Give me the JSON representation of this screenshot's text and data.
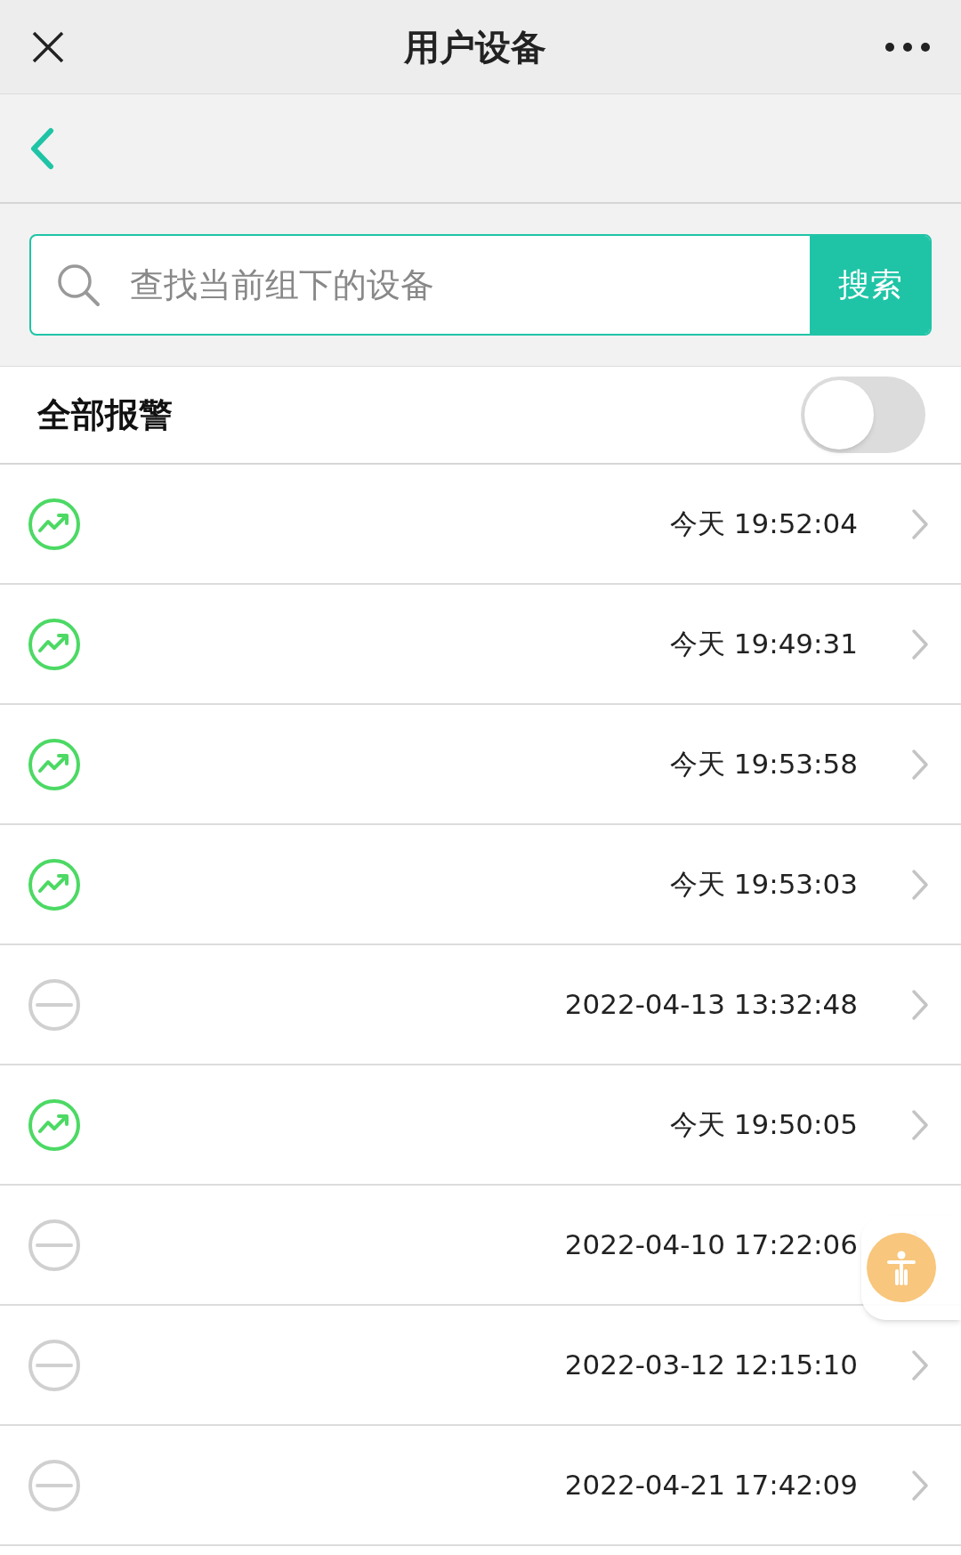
{
  "top_bar": {
    "title": "用户设备"
  },
  "search": {
    "placeholder": "查找当前组下的设备",
    "button": "搜索"
  },
  "alarm_toggle": {
    "label": "全部报警",
    "on": false
  },
  "devices": [
    {
      "online": true,
      "time": "今天 19:52:04"
    },
    {
      "online": true,
      "time": "今天 19:49:31"
    },
    {
      "online": true,
      "time": "今天 19:53:58"
    },
    {
      "online": true,
      "time": "今天 19:53:03"
    },
    {
      "online": false,
      "time": "2022-04-13 13:32:48"
    },
    {
      "online": true,
      "time": "今天 19:50:05"
    },
    {
      "online": false,
      "time": "2022-04-10 17:22:06"
    },
    {
      "online": false,
      "time": "2022-03-12 12:15:10"
    },
    {
      "online": false,
      "time": "2022-04-21 17:42:09"
    }
  ],
  "floating_button": {
    "kind": "accessibility"
  }
}
